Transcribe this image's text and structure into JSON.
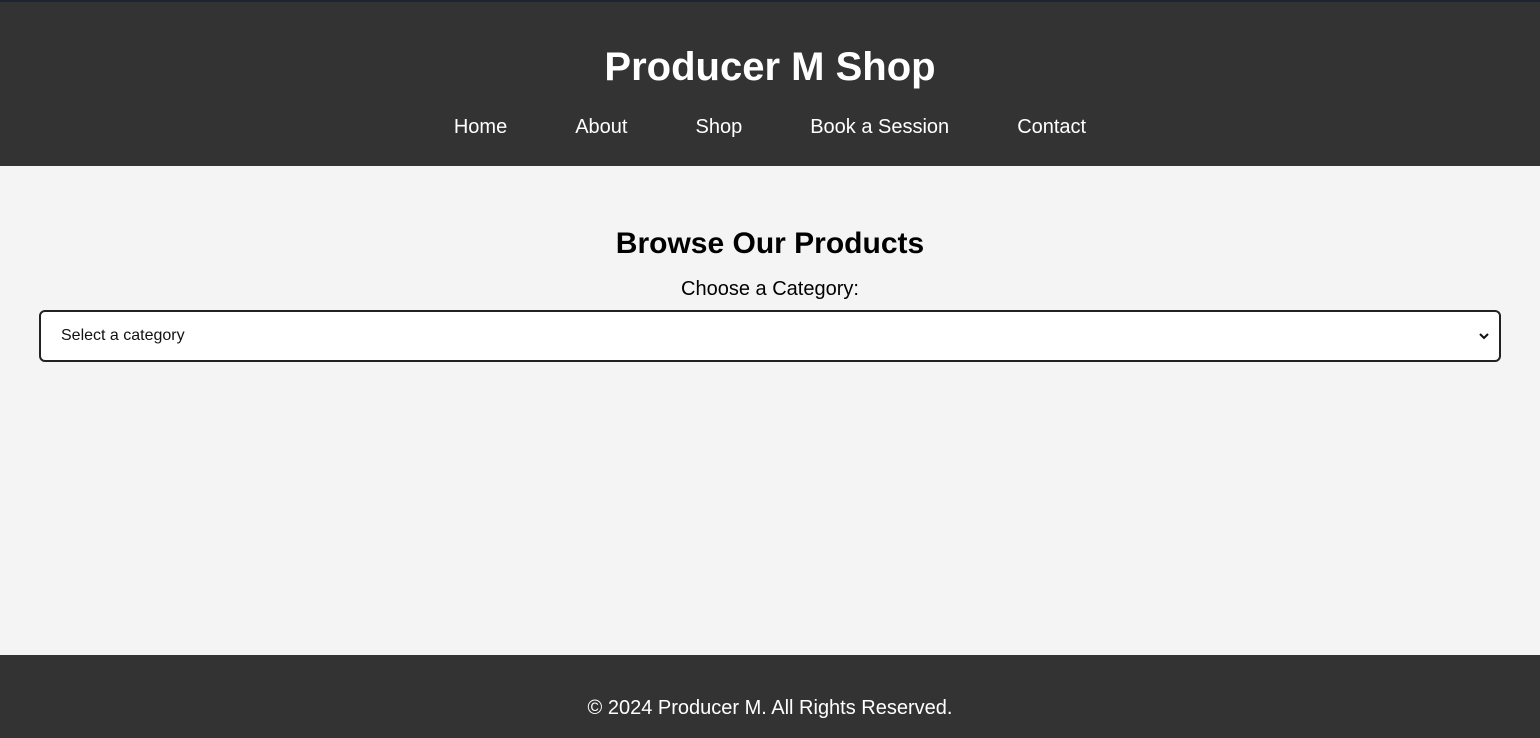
{
  "header": {
    "title": "Producer M Shop",
    "nav": [
      "Home",
      "About",
      "Shop",
      "Book a Session",
      "Contact"
    ]
  },
  "main": {
    "heading": "Browse Our Products",
    "category_label": "Choose a Category:",
    "select": {
      "value": "Select a category"
    }
  },
  "footer": {
    "text": "© 2024 Producer M. All Rights Reserved."
  }
}
